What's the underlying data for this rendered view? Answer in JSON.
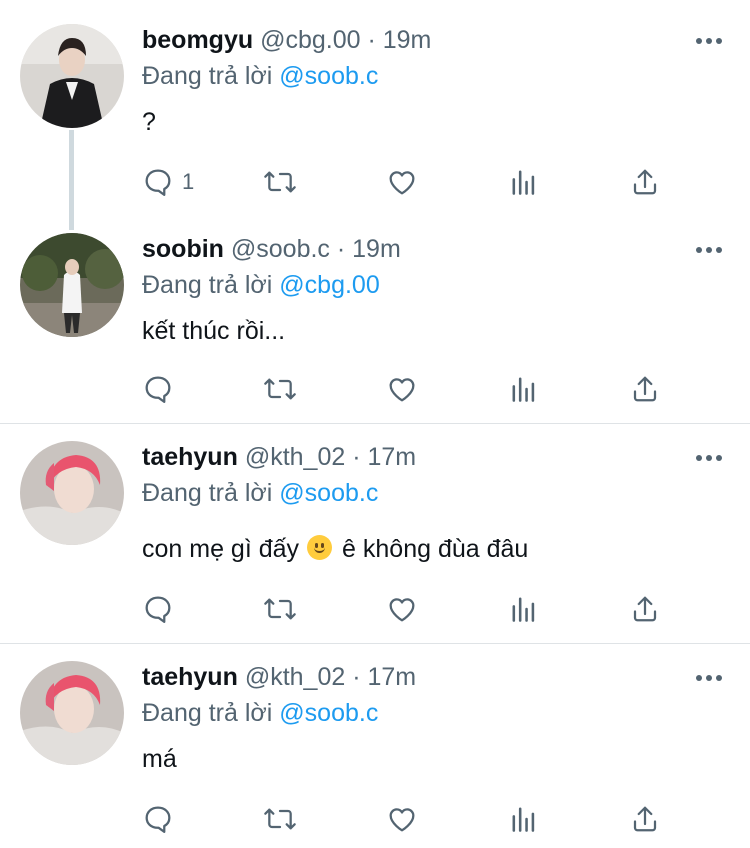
{
  "tweets": [
    {
      "name": "beomgyu",
      "meta": "@cbg.00 · 19m",
      "replying_prefix": "Đang trả lời",
      "replying_to": "@soob.c",
      "text": "?",
      "reply_count": "1"
    },
    {
      "name": "soobin",
      "meta": "@soob.c · 19m",
      "replying_prefix": "Đang trả lời",
      "replying_to": "@cbg.00",
      "text": "kết thúc rồi..."
    },
    {
      "name": "taehyun",
      "meta": "@kth_02 · 17m",
      "replying_prefix": "Đang trả lời",
      "replying_to": "@soob.c",
      "text_before": "con mẹ gì đấy",
      "text_after": "ê không đùa đâu"
    },
    {
      "name": "taehyun",
      "meta": "@kth_02 · 17m",
      "replying_prefix": "Đang trả lời",
      "replying_to": "@soob.c",
      "text": "má"
    }
  ],
  "icons": {
    "reply": "reply-icon",
    "retweet": "retweet-icon",
    "like": "heart-icon",
    "views": "analytics-icon",
    "share": "share-icon",
    "more": "more-icon",
    "emoji": "slightly-smiling-face"
  },
  "colors": {
    "mention": "#1d9bf0",
    "secondary_text": "#536471",
    "thread_line": "#cfd9de"
  }
}
